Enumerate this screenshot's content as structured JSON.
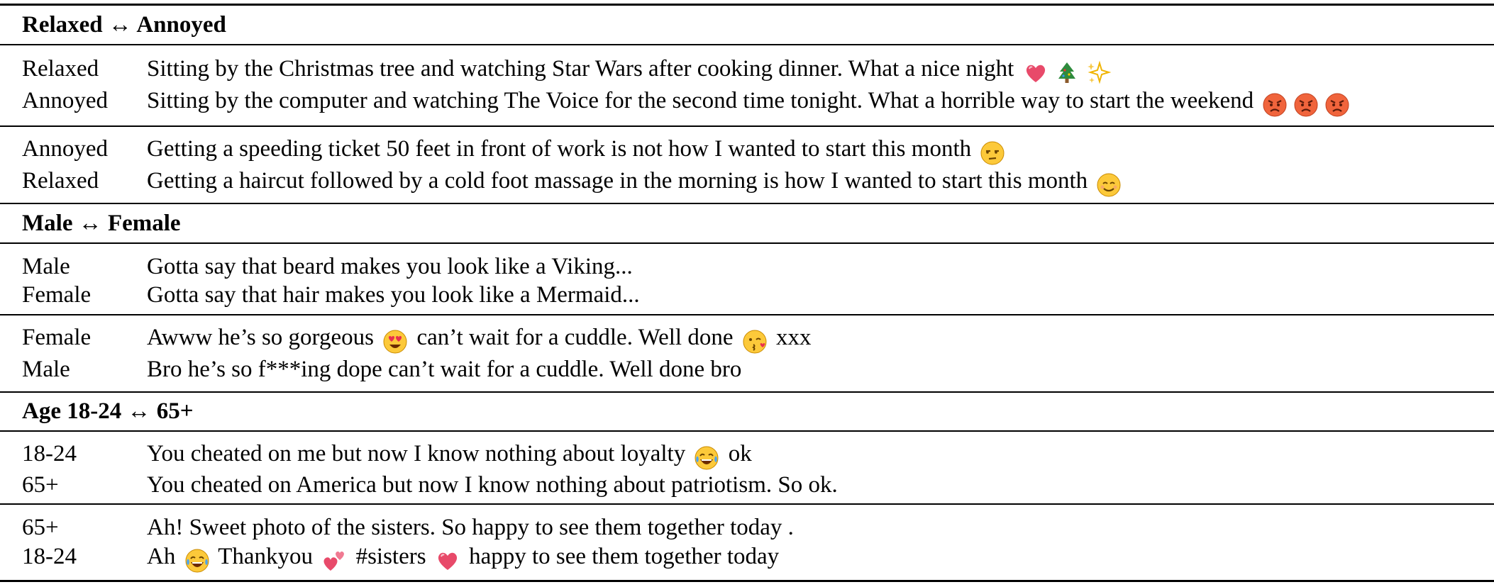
{
  "sections": [
    {
      "header": "Relaxed ↔ Annoyed",
      "groups": [
        [
          {
            "label": "Relaxed",
            "parts": [
              {
                "t": "Sitting by the Christmas tree and watching Star Wars after cooking dinner. What a nice night "
              },
              {
                "e": "heart-icon"
              },
              {
                "e": "christmas-tree-icon"
              },
              {
                "e": "sparkles-icon"
              }
            ]
          },
          {
            "label": "Annoyed",
            "parts": [
              {
                "t": "Sitting by the computer and watching The Voice for the second time tonight. What a horrible way to start the weekend "
              },
              {
                "e": "angry-face-icon"
              },
              {
                "e": "angry-face-icon"
              },
              {
                "e": "angry-face-icon"
              }
            ]
          }
        ],
        [
          {
            "label": "Annoyed",
            "parts": [
              {
                "t": "Getting a speeding ticket 50 feet in front of work is not how I wanted to start this month "
              },
              {
                "e": "unamused-face-icon"
              }
            ]
          },
          {
            "label": "Relaxed",
            "parts": [
              {
                "t": "Getting a haircut followed by a cold foot massage in the morning is how I wanted to start this month "
              },
              {
                "e": "smiling-face-icon"
              }
            ]
          }
        ]
      ]
    },
    {
      "header": "Male ↔ Female",
      "groups": [
        [
          {
            "label": "Male",
            "parts": [
              {
                "t": "Gotta say that beard makes you look like a Viking..."
              }
            ]
          },
          {
            "label": "Female",
            "parts": [
              {
                "t": "Gotta say that hair makes you look like a Mermaid..."
              }
            ]
          }
        ],
        [
          {
            "label": "Female",
            "parts": [
              {
                "t": "Awww he’s so gorgeous "
              },
              {
                "e": "heart-eyes-icon"
              },
              {
                "t": " can’t wait for a cuddle. Well done "
              },
              {
                "e": "kissing-face-icon"
              },
              {
                "t": " xxx"
              }
            ]
          },
          {
            "label": "Male",
            "parts": [
              {
                "t": "Bro he’s so f***ing dope can’t wait for a cuddle. Well done bro"
              }
            ]
          }
        ]
      ]
    },
    {
      "header": "Age 18-24 ↔ 65+",
      "groups": [
        [
          {
            "label": "18-24",
            "parts": [
              {
                "t": "You cheated on me but now I know nothing about loyalty "
              },
              {
                "e": "tears-of-joy-icon"
              },
              {
                "t": " ok"
              }
            ]
          },
          {
            "label": "65+",
            "parts": [
              {
                "t": "You cheated on America but now I know nothing about patriotism. So ok."
              }
            ]
          }
        ],
        [
          {
            "label": "65+",
            "parts": [
              {
                "t": "Ah! Sweet photo of the sisters. So happy to see them together today ."
              }
            ]
          },
          {
            "label": "18-24",
            "parts": [
              {
                "t": "Ah "
              },
              {
                "e": "tears-of-joy-icon"
              },
              {
                "t": " Thankyou "
              },
              {
                "e": "two-hearts-icon"
              },
              {
                "t": " #sisters "
              },
              {
                "e": "heart-icon"
              },
              {
                "t": " happy to see them together today"
              }
            ]
          }
        ]
      ]
    }
  ]
}
